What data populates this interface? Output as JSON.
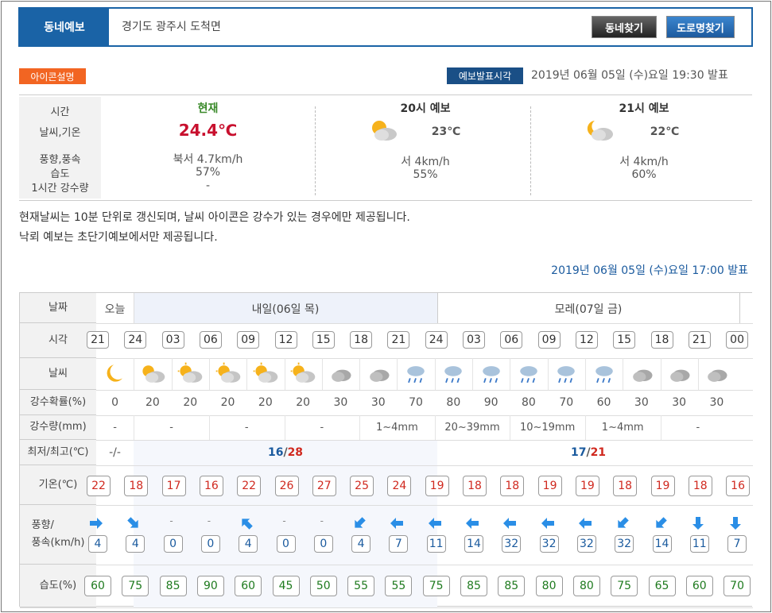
{
  "header": {
    "tab_title": "동네예보",
    "region": "경기도 광주시 도척면",
    "btn_local": "동네찾기",
    "btn_road": "도로명찾기"
  },
  "icon_help": "아이콘설명",
  "publish_badge": "예보발표시각",
  "publish_time": "2019년 06월 05일 (수)요일 19:30 발표",
  "current": {
    "labels": [
      "시간",
      "날씨,기온",
      "풍향,풍속",
      "습도",
      "1시간 강수량"
    ],
    "now": {
      "title": "현재",
      "temp": "24.4℃",
      "wind": "북서 4.7km/h",
      "humidity": "57%",
      "rain": "-"
    },
    "h20": {
      "title": "20시 예보",
      "temp": "23℃",
      "wind": "서 4km/h",
      "humidity": "55%"
    },
    "h21": {
      "title": "21시 예보",
      "temp": "22℃",
      "wind": "서 4km/h",
      "humidity": "60%"
    }
  },
  "notes": [
    "현재날씨는 10분 단위로 갱신되며, 날씨 아이콘은 강수가 있는 경우에만 제공됩니다.",
    "낙뢰 예보는 초단기예보에서만 제공됩니다."
  ],
  "forecast_publish": "2019년 06월 05일 (수)요일 17:00 발표",
  "grid": {
    "row_labels": {
      "date": "날짜",
      "time": "시각",
      "weather": "날씨",
      "pop": "강수확률(%)",
      "rain": "강수량(mm)",
      "minmax": "최저/최고(℃)",
      "temp": "기온(℃)",
      "wind": "풍향/\n풍속(km/h)",
      "humid": "습도(%)"
    },
    "dates": {
      "today": "오늘",
      "tomorrow": "내일(06일 목)",
      "dayafter": "모레(07일 금)"
    },
    "times": [
      "21",
      "24",
      "03",
      "06",
      "09",
      "12",
      "15",
      "18",
      "21",
      "24",
      "03",
      "06",
      "09",
      "12",
      "15",
      "18",
      "21",
      "00"
    ],
    "weather": [
      "moon",
      "pcloudy",
      "psunny",
      "psunny",
      "psunny",
      "psunny",
      "cloudy",
      "cloudy",
      "rain",
      "rain",
      "rain",
      "rain",
      "rain",
      "rain",
      "cloudy",
      "cloudy",
      "cloudy"
    ],
    "pop": [
      "0",
      "20",
      "20",
      "20",
      "20",
      "20",
      "30",
      "30",
      "70",
      "80",
      "90",
      "80",
      "70",
      "60",
      "30",
      "30",
      "30"
    ],
    "rain_groups": [
      {
        "text": "-"
      },
      {
        "text": "-"
      },
      {
        "text": "-"
      },
      {
        "text": "-"
      },
      {
        "text": "1~4mm"
      },
      {
        "text": "20~39mm"
      },
      {
        "text": "10~19mm"
      },
      {
        "text": "1~4mm"
      },
      {
        "text": "-"
      }
    ],
    "minmax": {
      "today": "-/-",
      "tomorrow_min": "16",
      "tomorrow_max": "28",
      "dayafter_min": "17",
      "dayafter_max": "21"
    },
    "temps": [
      "22",
      "18",
      "17",
      "16",
      "22",
      "26",
      "27",
      "25",
      "24",
      "19",
      "18",
      "18",
      "19",
      "19",
      "18",
      "19",
      "18",
      "16"
    ],
    "wind_dirs": [
      "E",
      "SE",
      "",
      "",
      "NW",
      "",
      "",
      "SW",
      "W",
      "W",
      "W",
      "W",
      "W",
      "W",
      "SW",
      "SW",
      "S",
      "S"
    ],
    "wind_speeds": [
      "4",
      "4",
      "0",
      "0",
      "4",
      "0",
      "0",
      "4",
      "7",
      "11",
      "14",
      "32",
      "32",
      "32",
      "32",
      "14",
      "11",
      "7"
    ],
    "humidity": [
      "60",
      "75",
      "85",
      "90",
      "60",
      "45",
      "50",
      "55",
      "55",
      "75",
      "85",
      "85",
      "80",
      "80",
      "75",
      "65",
      "60",
      "70"
    ],
    "colors": {
      "accent": "#1a63a6",
      "red": "#d0291f",
      "green": "#1e7a1e",
      "arrow": "#2a8ee6"
    }
  }
}
